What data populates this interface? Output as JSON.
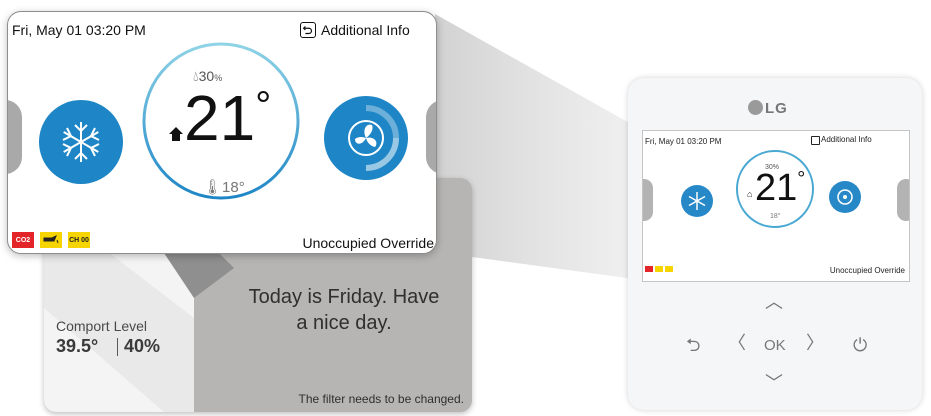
{
  "zoom": {
    "date_time": "Fri, May 01  03:20 PM",
    "info_label": "Additional Info",
    "humidity": "30",
    "humidity_unit": "%",
    "temperature": "21",
    "degree": "°",
    "set_temperature": "18°",
    "status_badges": [
      "CO2",
      "",
      "CH 00"
    ],
    "override_label": "Unoccupied Override",
    "accent_color": "#1e86c6"
  },
  "back_screen": {
    "comfort_label": "Comport Level",
    "comfort_temp": "39.5°",
    "comfort_humidity": "40%",
    "greeting_line1": "Today is Friday. Have",
    "greeting_line2": "a nice day.",
    "filter_message": "The filter needs to be changed."
  },
  "device": {
    "brand": "LG",
    "date_time": "Fri, May 01  03:20 PM",
    "info_label": "Additional Info",
    "humidity": "30",
    "humidity_unit": "%",
    "temperature": "21",
    "degree": "°",
    "set_temperature": "18°",
    "override_label": "Unoccupied Override",
    "keys": {
      "up": "︿",
      "down": "﹀",
      "back": "⮌",
      "left": "〈",
      "ok": "OK",
      "right": "〉",
      "power": "⏻"
    },
    "icons": {
      "up": "chevron-up-icon",
      "down": "chevron-down-icon",
      "back": "back-icon",
      "left": "chevron-left-icon",
      "right": "chevron-right-icon",
      "power": "power-icon"
    }
  }
}
